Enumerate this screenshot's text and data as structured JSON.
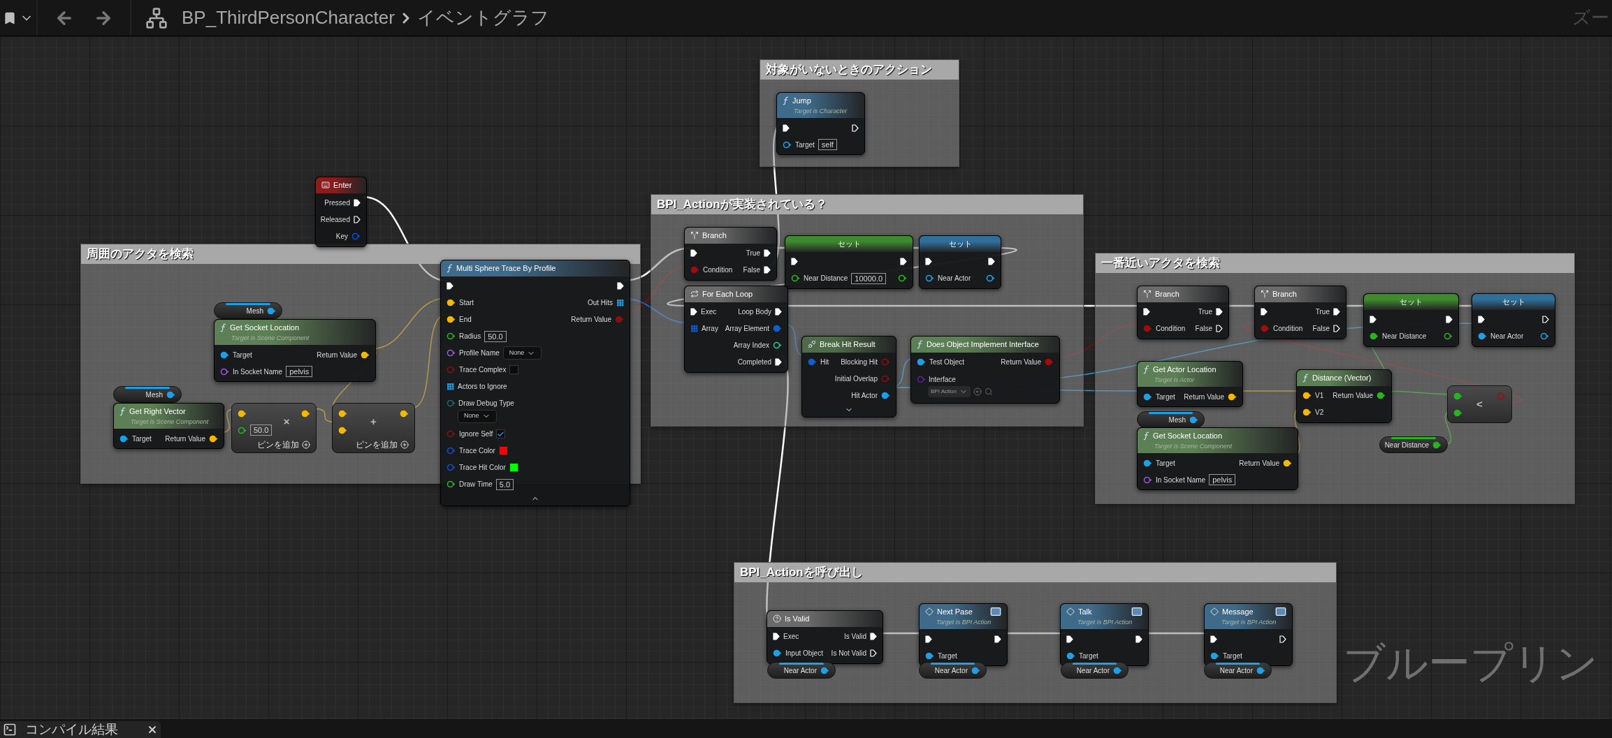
{
  "toolbar": {
    "breadcrumb": [
      "BP_ThirdPersonCharacter",
      "イベントグラフ"
    ],
    "zoom_label": "ズー"
  },
  "comments": [
    {
      "title": "周囲のアクタを検索"
    },
    {
      "title": "対象がいないときのアクション"
    },
    {
      "title": "BPI_Actionが実装されている？"
    },
    {
      "title": "一番近いアクタを検索"
    },
    {
      "title": "BPI_Actionを呼び出し"
    }
  ],
  "watermark": "ブループリン",
  "nodes": [
    {
      "kind": "event",
      "title": "Enter",
      "color": "#8b1c1c",
      "outputs": [
        {
          "kind": "exec",
          "label": "Pressed",
          "connected": true
        },
        {
          "kind": "exec",
          "label": "Released",
          "connected": false
        },
        {
          "kind": "data",
          "label": "Key",
          "color": "#0a4fd6",
          "connected": false
        }
      ]
    },
    {
      "kind": "call",
      "title": "Multi Sphere Trace By Profile",
      "color": "#3f6a8a",
      "expanded": true,
      "inputs": [
        {
          "kind": "exec",
          "connected": true
        },
        {
          "kind": "data",
          "label": "Start",
          "color": "#f5b800",
          "connected": true
        },
        {
          "kind": "data",
          "label": "End",
          "color": "#f5b800",
          "connected": true
        },
        {
          "kind": "data",
          "label": "Radius",
          "color": "#26b51f",
          "connected": false,
          "field": {
            "kind": "text",
            "value": "50.0"
          }
        },
        {
          "kind": "data",
          "label": "Profile Name",
          "color": "#9d55d8",
          "connected": false,
          "field": {
            "kind": "dropdown",
            "value": "None"
          }
        },
        {
          "kind": "data",
          "label": "Trace Complex",
          "color": "#8a0f0f",
          "connected": false,
          "field": {
            "kind": "checkbox",
            "checked": false
          }
        },
        {
          "kind": "array",
          "label": "Actors to Ignore",
          "color": "#1ea0e8"
        },
        {
          "kind": "data",
          "label": "Draw Debug Type",
          "color": "#0e6f6a",
          "connected": false,
          "field": {
            "kind": "dropdown",
            "value": "None"
          }
        },
        {
          "kind": "data",
          "label": "Ignore Self",
          "color": "#8a0f0f",
          "connected": false,
          "field": {
            "kind": "checkbox",
            "checked": true
          }
        },
        {
          "kind": "data",
          "label": "Trace Color",
          "color": "#0a4fd6",
          "connected": false,
          "field": {
            "kind": "swatch",
            "color": "#ff0000"
          }
        },
        {
          "kind": "data",
          "label": "Trace Hit Color",
          "color": "#0a4fd6",
          "connected": false,
          "field": {
            "kind": "swatch",
            "color": "#00ff00"
          }
        },
        {
          "kind": "data",
          "label": "Draw Time",
          "color": "#26b51f",
          "connected": false,
          "field": {
            "kind": "text",
            "value": "5.0"
          }
        }
      ],
      "outputs": [
        {
          "kind": "exec",
          "connected": true
        },
        {
          "kind": "array",
          "label": "Out Hits",
          "color": "#1ea0e8"
        },
        {
          "kind": "data",
          "label": "Return Value",
          "color": "#8a0f0f",
          "connected": true
        }
      ]
    },
    {
      "kind": "variable",
      "color": "#1ea0e8",
      "outputs": [
        {
          "kind": "data",
          "label": "Mesh",
          "color": "#1ea0e8",
          "connected": true
        }
      ]
    },
    {
      "kind": "function",
      "title": "Get Socket Location",
      "subtitle": "Target is Scene Component",
      "color": "#5d7f55",
      "inputs": [
        {
          "kind": "data",
          "label": "Target",
          "color": "#1ea0e8",
          "connected": true
        },
        {
          "kind": "data",
          "label": "In Socket Name",
          "color": "#9d55d8",
          "connected": false,
          "field": {
            "kind": "text",
            "value": "pelvis"
          }
        }
      ],
      "outputs": [
        {
          "kind": "data",
          "label": "Return Value",
          "color": "#f5b800",
          "connected": true
        }
      ]
    },
    {
      "kind": "variable",
      "color": "#1ea0e8",
      "outputs": [
        {
          "kind": "data",
          "label": "Mesh",
          "color": "#1ea0e8",
          "connected": true
        }
      ]
    },
    {
      "kind": "function",
      "title": "Get Right Vector",
      "subtitle": "Target is Scene Component",
      "color": "#5d7f55",
      "inputs": [
        {
          "kind": "data",
          "label": "Target",
          "color": "#1ea0e8",
          "connected": true
        }
      ],
      "outputs": [
        {
          "kind": "data",
          "label": "Return Value",
          "color": "#f5b800",
          "connected": true
        }
      ]
    },
    {
      "kind": "operator",
      "symbol": "×",
      "add_pin": "ピンを追加",
      "inputs": [
        {
          "kind": "data",
          "color": "#f5b800",
          "connected": true
        },
        {
          "kind": "data",
          "color": "#26b51f",
          "connected": false,
          "field": {
            "kind": "text",
            "value": "50.0"
          }
        }
      ],
      "outputs": [
        {
          "kind": "data",
          "color": "#f5b800",
          "connected": true
        }
      ]
    },
    {
      "kind": "operator",
      "symbol": "+",
      "add_pin": "ピンを追加",
      "inputs": [
        {
          "kind": "data",
          "color": "#f5b800",
          "connected": true
        },
        {
          "kind": "data",
          "color": "#f5b800",
          "connected": true
        }
      ],
      "outputs": [
        {
          "kind": "data",
          "color": "#f5b800",
          "connected": true
        }
      ]
    },
    {
      "kind": "call",
      "title": "Jump",
      "subtitle": "Target is Character",
      "color": "#3f6a8a",
      "inputs": [
        {
          "kind": "exec",
          "connected": true
        },
        {
          "kind": "data",
          "label": "Target",
          "color": "#1ea0e8",
          "connected": false,
          "field": {
            "kind": "text",
            "value": "self"
          }
        }
      ],
      "outputs": [
        {
          "kind": "exec",
          "connected": false
        }
      ]
    },
    {
      "kind": "branch",
      "title": "Branch",
      "color": "#6a6a6a",
      "inputs": [
        {
          "kind": "exec",
          "connected": true
        },
        {
          "kind": "data",
          "label": "Condition",
          "color": "#a00d0d",
          "connected": true
        }
      ],
      "outputs": [
        {
          "kind": "exec",
          "label": "True",
          "connected": true
        },
        {
          "kind": "exec",
          "label": "False",
          "connected": true
        }
      ]
    },
    {
      "kind": "set",
      "title": "セット",
      "color": "#3f8a2e",
      "inputs": [
        {
          "kind": "exec",
          "connected": true
        },
        {
          "kind": "data",
          "label": "Near Distance",
          "color": "#26b51f",
          "connected": false,
          "field": {
            "kind": "text",
            "value": "10000.0"
          }
        }
      ],
      "outputs": [
        {
          "kind": "exec",
          "connected": true
        },
        {
          "kind": "data",
          "color": "#26b51f",
          "connected": false
        }
      ]
    },
    {
      "kind": "set",
      "title": "セット",
      "color": "#2f6f9a",
      "inputs": [
        {
          "kind": "exec",
          "connected": true
        },
        {
          "kind": "data",
          "label": "Near Actor",
          "color": "#1ea0e8",
          "connected": false
        }
      ],
      "outputs": [
        {
          "kind": "exec",
          "connected": true
        },
        {
          "kind": "data",
          "color": "#1ea0e8",
          "connected": false
        }
      ]
    },
    {
      "kind": "loop",
      "title": "For Each Loop",
      "color": "#6a6a6a",
      "inputs": [
        {
          "kind": "exec",
          "label": "Exec",
          "connected": true
        },
        {
          "kind": "array",
          "label": "Array",
          "color": "#0a5fd6"
        }
      ],
      "outputs": [
        {
          "kind": "exec",
          "label": "Loop Body",
          "connected": true
        },
        {
          "kind": "data",
          "label": "Array Element",
          "color": "#0a5fd6",
          "connected": true
        },
        {
          "kind": "data",
          "label": "Array Index",
          "color": "#1ec98a",
          "connected": false
        },
        {
          "kind": "exec",
          "label": "Completed",
          "connected": true
        }
      ]
    },
    {
      "kind": "break",
      "title": "Break Hit Result",
      "color": "#4f6b4a",
      "expanded": false,
      "inputs": [
        {
          "kind": "data",
          "label": "Hit",
          "color": "#0a5fd6",
          "connected": true
        }
      ],
      "outputs": [
        {
          "kind": "data",
          "label": "Blocking Hit",
          "color": "#8a0f0f",
          "connected": false
        },
        {
          "kind": "data",
          "label": "Initial Overlap",
          "color": "#8a0f0f",
          "connected": false
        },
        {
          "kind": "data",
          "label": "Hit Actor",
          "color": "#1ea0e8",
          "connected": true
        }
      ]
    },
    {
      "kind": "function",
      "title": "Does Object Implement Interface",
      "color": "#5d7f55",
      "inputs": [
        {
          "kind": "data",
          "label": "Test Object",
          "color": "#1ea0e8",
          "connected": true
        },
        {
          "kind": "data",
          "label": "Interface",
          "color": "#5b1fa6",
          "connected": false,
          "field": {
            "kind": "asset",
            "value": "BPI Action"
          }
        }
      ],
      "outputs": [
        {
          "kind": "data",
          "label": "Return Value",
          "color": "#a00d0d",
          "connected": true
        }
      ]
    },
    {
      "kind": "branch",
      "title": "Branch",
      "color": "#6a6a6a",
      "inputs": [
        {
          "kind": "exec",
          "connected": true
        },
        {
          "kind": "data",
          "label": "Condition",
          "color": "#a00d0d",
          "connected": true
        }
      ],
      "outputs": [
        {
          "kind": "exec",
          "label": "True",
          "connected": true
        },
        {
          "kind": "exec",
          "label": "False",
          "connected": false
        }
      ]
    },
    {
      "kind": "branch",
      "title": "Branch",
      "color": "#6a6a6a",
      "inputs": [
        {
          "kind": "exec",
          "connected": true
        },
        {
          "kind": "data",
          "label": "Condition",
          "color": "#a00d0d",
          "connected": true
        }
      ],
      "outputs": [
        {
          "kind": "exec",
          "label": "True",
          "connected": true
        },
        {
          "kind": "exec",
          "label": "False",
          "connected": false
        }
      ]
    },
    {
      "kind": "set",
      "title": "セット",
      "color": "#3f8a2e",
      "inputs": [
        {
          "kind": "exec",
          "connected": true
        },
        {
          "kind": "data",
          "label": "Near Distance",
          "color": "#26b51f",
          "connected": true
        }
      ],
      "outputs": [
        {
          "kind": "exec",
          "connected": true
        },
        {
          "kind": "data",
          "color": "#26b51f",
          "connected": false
        }
      ]
    },
    {
      "kind": "set",
      "title": "セット",
      "color": "#2f6f9a",
      "inputs": [
        {
          "kind": "exec",
          "connected": true
        },
        {
          "kind": "data",
          "label": "Near Actor",
          "color": "#1ea0e8",
          "connected": true
        }
      ],
      "outputs": [
        {
          "kind": "exec",
          "connected": false
        },
        {
          "kind": "data",
          "color": "#1ea0e8",
          "connected": false
        }
      ]
    },
    {
      "kind": "function",
      "title": "Get Actor Location",
      "subtitle": "Target is Actor",
      "color": "#5d7f55",
      "inputs": [
        {
          "kind": "data",
          "label": "Target",
          "color": "#1ea0e8",
          "connected": true
        }
      ],
      "outputs": [
        {
          "kind": "data",
          "label": "Return Value",
          "color": "#f5b800",
          "connected": true
        }
      ]
    },
    {
      "kind": "variable",
      "color": "#1ea0e8",
      "outputs": [
        {
          "kind": "data",
          "label": "Mesh",
          "color": "#1ea0e8",
          "connected": true
        }
      ]
    },
    {
      "kind": "function",
      "title": "Get Socket Location",
      "subtitle": "Target is Scene Component",
      "color": "#5d7f55",
      "inputs": [
        {
          "kind": "data",
          "label": "Target",
          "color": "#1ea0e8",
          "connected": true
        },
        {
          "kind": "data",
          "label": "In Socket Name",
          "color": "#9d55d8",
          "connected": false,
          "field": {
            "kind": "text",
            "value": "pelvis"
          }
        }
      ],
      "outputs": [
        {
          "kind": "data",
          "label": "Return Value",
          "color": "#f5b800",
          "connected": true
        }
      ]
    },
    {
      "kind": "function",
      "title": "Distance (Vector)",
      "color": "#5d7f55",
      "inputs": [
        {
          "kind": "data",
          "label": "V1",
          "color": "#f5b800",
          "connected": true
        },
        {
          "kind": "data",
          "label": "V2",
          "color": "#f5b800",
          "connected": true
        }
      ],
      "outputs": [
        {
          "kind": "data",
          "label": "Return Value",
          "color": "#26b51f",
          "connected": true
        }
      ]
    },
    {
      "kind": "operator",
      "symbol": "<",
      "inputs": [
        {
          "kind": "data",
          "color": "#26b51f",
          "connected": true
        },
        {
          "kind": "data",
          "color": "#26b51f",
          "connected": true
        }
      ],
      "outputs": [
        {
          "kind": "data",
          "color": "#a00d0d",
          "connected": false
        }
      ]
    },
    {
      "kind": "variable",
      "color": "#26b51f",
      "outputs": [
        {
          "kind": "data",
          "label": "Near Distance",
          "color": "#26b51f",
          "connected": true
        }
      ]
    },
    {
      "kind": "validate",
      "title": "Is Valid",
      "color": "#6a6a6a",
      "inputs": [
        {
          "kind": "exec",
          "label": "Exec",
          "connected": true
        },
        {
          "kind": "data",
          "label": "Input Object",
          "color": "#1ea0e8",
          "connected": true
        }
      ],
      "outputs": [
        {
          "kind": "exec",
          "label": "Is Valid",
          "connected": true
        },
        {
          "kind": "exec",
          "label": "Is Not Valid",
          "connected": false
        }
      ]
    },
    {
      "kind": "variable",
      "color": "#1ea0e8",
      "outputs": [
        {
          "kind": "data",
          "label": "Near Actor",
          "color": "#1ea0e8",
          "connected": true
        }
      ]
    },
    {
      "kind": "message",
      "title": "Next Pase",
      "subtitle": "Target is BPI Action",
      "color": "#3f6a8a",
      "inputs": [
        {
          "kind": "exec",
          "connected": true
        },
        {
          "kind": "data",
          "label": "Target",
          "color": "#1ea0e8",
          "connected": true
        }
      ],
      "outputs": [
        {
          "kind": "exec",
          "connected": true
        }
      ]
    },
    {
      "kind": "variable",
      "color": "#1ea0e8",
      "outputs": [
        {
          "kind": "data",
          "label": "Near Actor",
          "color": "#1ea0e8",
          "connected": true
        }
      ]
    },
    {
      "kind": "message",
      "title": "Talk",
      "subtitle": "Target is BPI Action",
      "color": "#3f6a8a",
      "inputs": [
        {
          "kind": "exec",
          "connected": true
        },
        {
          "kind": "data",
          "label": "Target",
          "color": "#1ea0e8",
          "connected": true
        }
      ],
      "outputs": [
        {
          "kind": "exec",
          "connected": true
        }
      ]
    },
    {
      "kind": "variable",
      "color": "#1ea0e8",
      "outputs": [
        {
          "kind": "data",
          "label": "Near Actor",
          "color": "#1ea0e8",
          "connected": true
        }
      ]
    },
    {
      "kind": "message",
      "title": "Message",
      "subtitle": "Target is BPI Action",
      "color": "#3f6a8a",
      "inputs": [
        {
          "kind": "exec",
          "connected": true
        },
        {
          "kind": "data",
          "label": "Target",
          "color": "#1ea0e8",
          "connected": true
        }
      ],
      "outputs": [
        {
          "kind": "exec",
          "connected": false
        }
      ]
    },
    {
      "kind": "variable",
      "color": "#1ea0e8",
      "outputs": [
        {
          "kind": "data",
          "label": "Near Actor",
          "color": "#1ea0e8",
          "connected": true
        }
      ]
    }
  ],
  "bottom_tab": {
    "label": "コンパイル結果"
  }
}
